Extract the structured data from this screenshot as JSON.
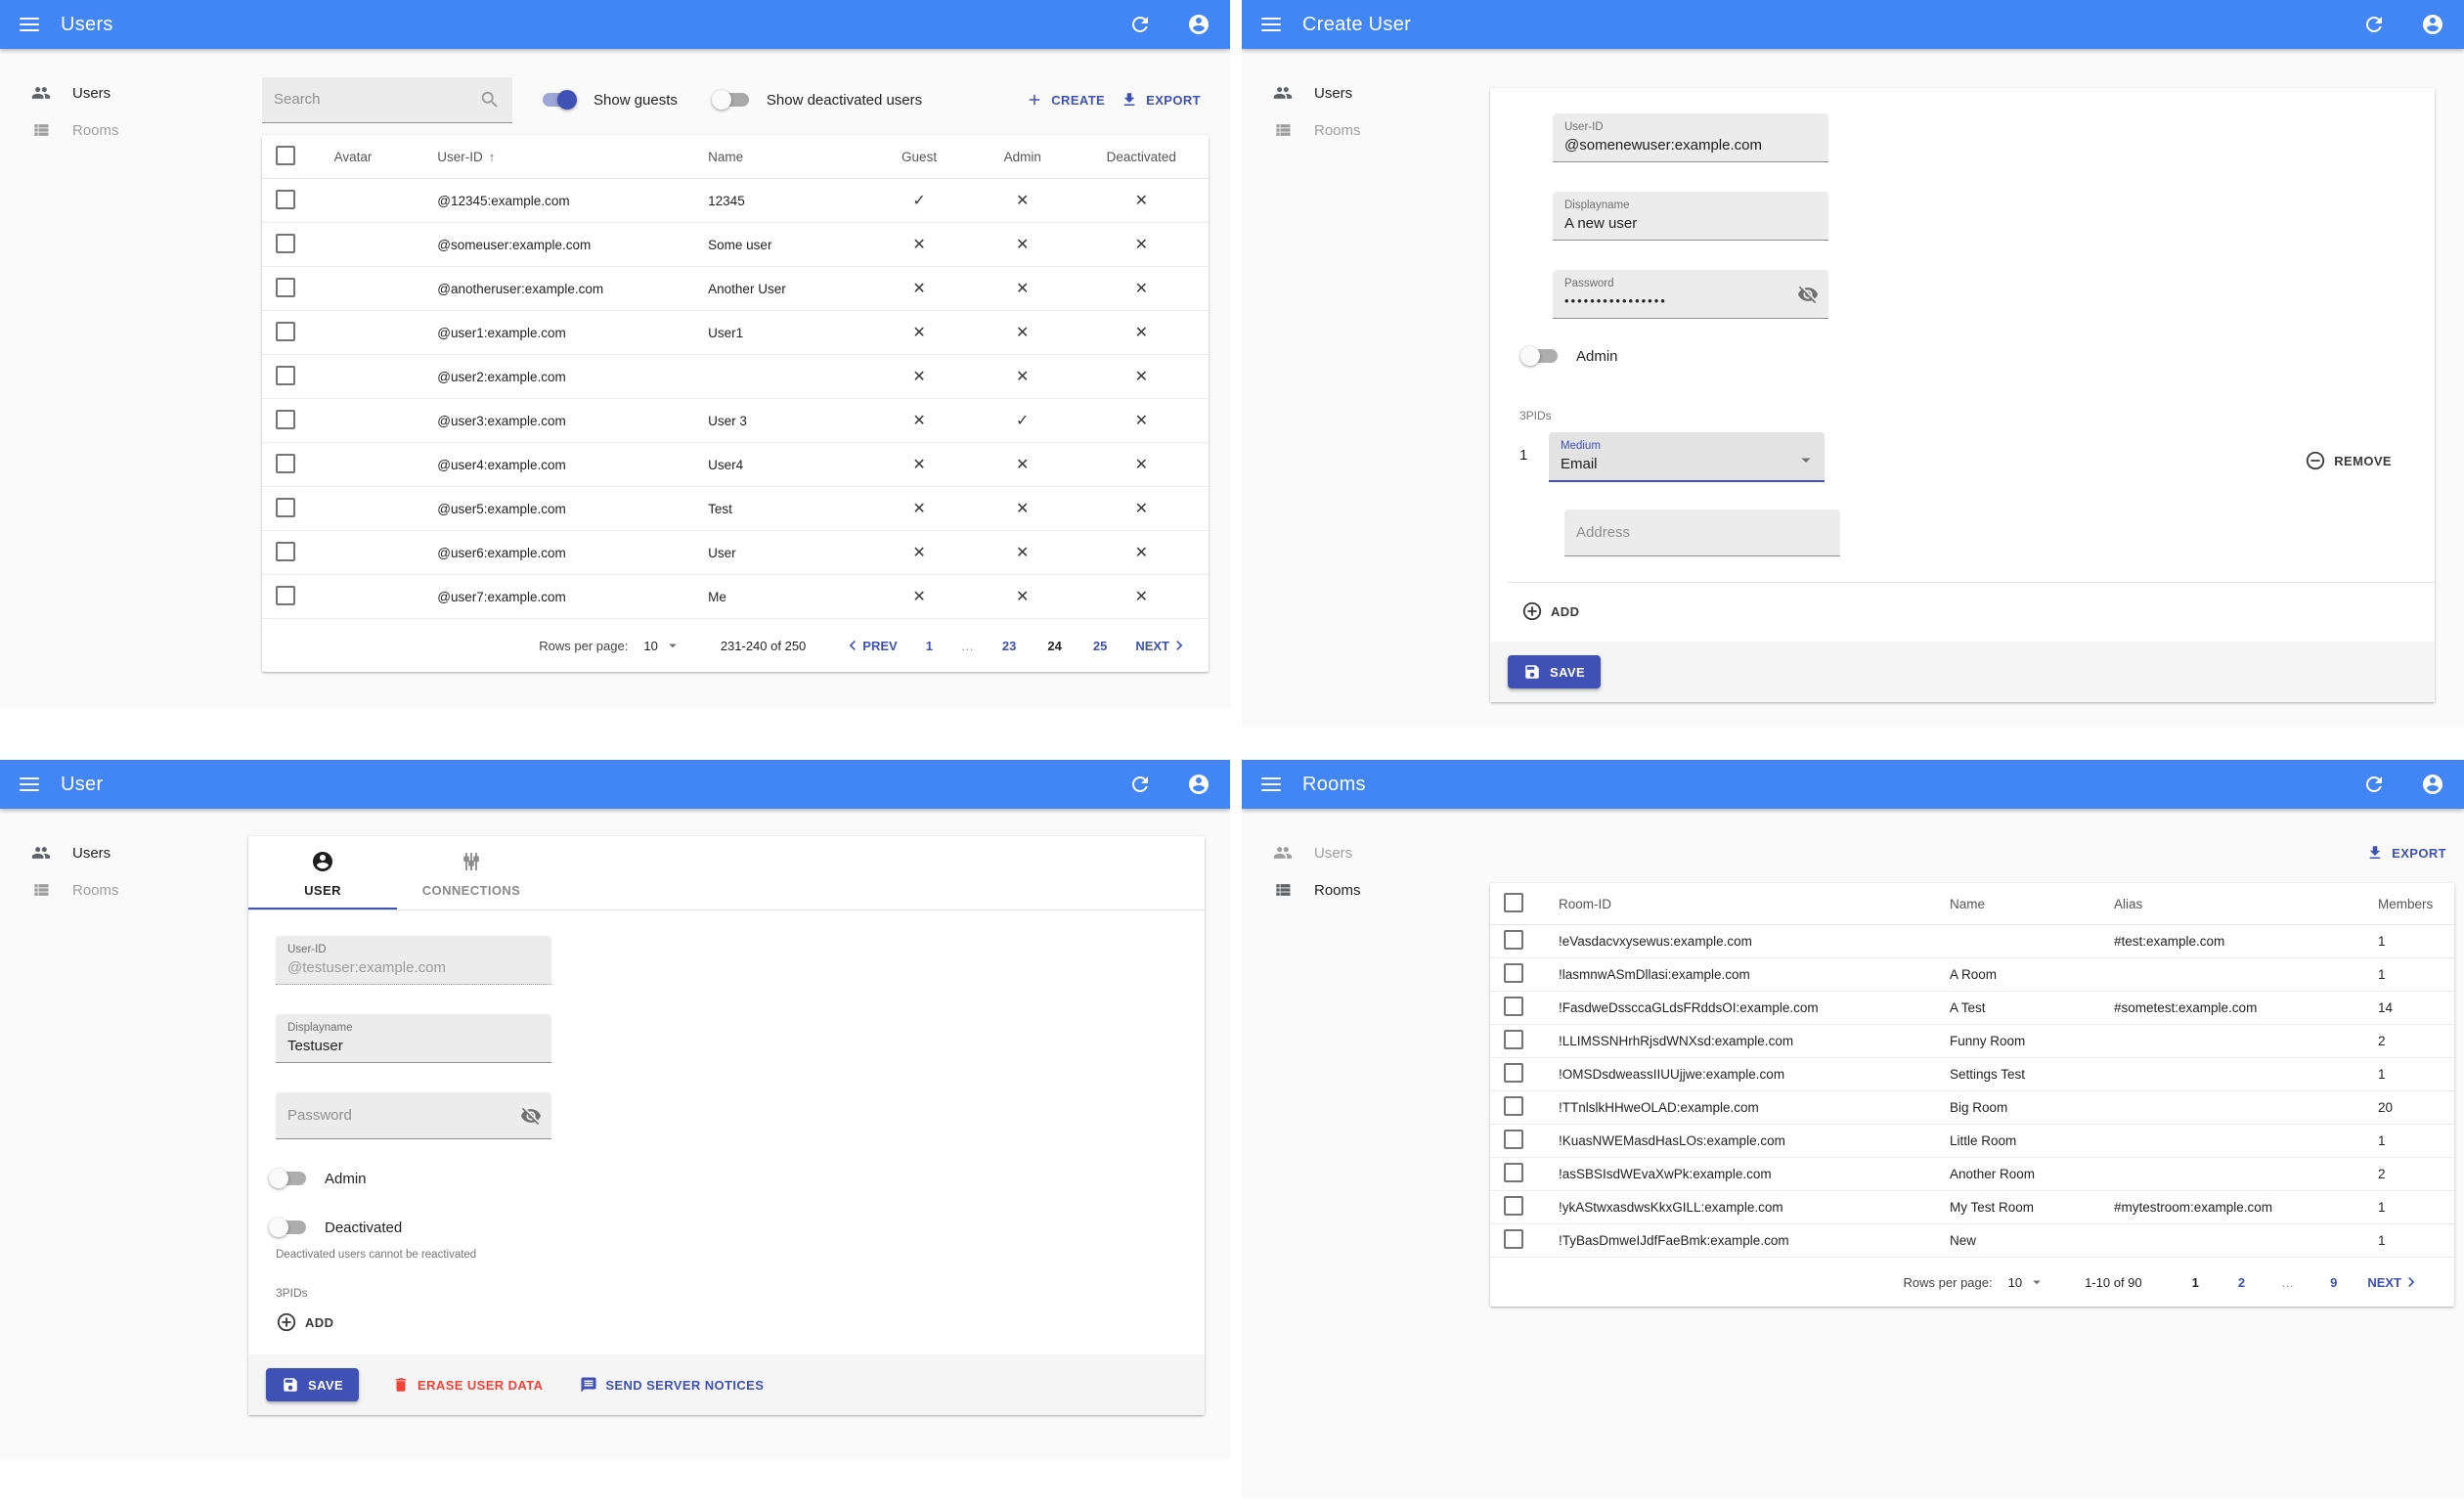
{
  "glyphs": {
    "check": "✓",
    "cross": "✕",
    "sort_up": "↑",
    "caret": "▾"
  },
  "colors": {
    "appbar": "#4285f4",
    "primary": "#3f51b5",
    "danger": "#f44336",
    "content_bg": "#fafafa"
  },
  "panels": {
    "users_list": {
      "appbar_title": "Users",
      "sidebar": {
        "users": "Users",
        "rooms": "Rooms"
      },
      "search_placeholder": "Search",
      "show_guests_label": "Show guests",
      "show_guests_on": true,
      "show_deactivated_label": "Show deactivated users",
      "show_deactivated_on": false,
      "create_label": "CREATE",
      "export_label": "EXPORT",
      "table": {
        "headers": {
          "avatar": "Avatar",
          "user_id": "User-ID",
          "name": "Name",
          "guest": "Guest",
          "admin": "Admin",
          "deactivated": "Deactivated"
        },
        "rows": [
          {
            "user_id": "@12345:example.com",
            "name": "12345",
            "guest": true,
            "admin": false,
            "deactivated": false
          },
          {
            "user_id": "@someuser:example.com",
            "name": "Some user",
            "guest": false,
            "admin": false,
            "deactivated": false
          },
          {
            "user_id": "@anotheruser:example.com",
            "name": "Another User",
            "guest": false,
            "admin": false,
            "deactivated": false
          },
          {
            "user_id": "@user1:example.com",
            "name": "User1",
            "guest": false,
            "admin": false,
            "deactivated": false
          },
          {
            "user_id": "@user2:example.com",
            "name": "",
            "guest": false,
            "admin": false,
            "deactivated": false
          },
          {
            "user_id": "@user3:example.com",
            "name": "User 3",
            "guest": false,
            "admin": true,
            "deactivated": false
          },
          {
            "user_id": "@user4:example.com",
            "name": "User4",
            "guest": false,
            "admin": false,
            "deactivated": false
          },
          {
            "user_id": "@user5:example.com",
            "name": "Test",
            "guest": false,
            "admin": false,
            "deactivated": false
          },
          {
            "user_id": "@user6:example.com",
            "name": "User",
            "guest": false,
            "admin": false,
            "deactivated": false
          },
          {
            "user_id": "@user7:example.com",
            "name": "Me",
            "guest": false,
            "admin": false,
            "deactivated": false
          }
        ]
      },
      "pagination": {
        "rows_per_page_label": "Rows per page:",
        "rows_per_page": "10",
        "range": "231-240 of 250",
        "prev_label": "PREV",
        "next_label": "NEXT",
        "pages": [
          {
            "label": "1",
            "state": "link"
          },
          {
            "label": "…",
            "state": "gap"
          },
          {
            "label": "23",
            "state": "link"
          },
          {
            "label": "24",
            "state": "current"
          },
          {
            "label": "25",
            "state": "link"
          }
        ]
      }
    },
    "create_user": {
      "appbar_title": "Create User",
      "sidebar": {
        "users": "Users",
        "rooms": "Rooms"
      },
      "fields": {
        "user_id_label": "User-ID",
        "user_id_value": "@somenewuser:example.com",
        "displayname_label": "Displayname",
        "displayname_value": "A new user",
        "password_label": "Password",
        "password_value": "••••••••••••••••",
        "admin_label": "Admin",
        "threepids_label": "3PIDs",
        "threepid_index": "1",
        "medium_label": "Medium",
        "medium_value": "Email",
        "address_placeholder": "Address"
      },
      "remove_label": "REMOVE",
      "add_label": "ADD",
      "save_label": "SAVE"
    },
    "user_edit": {
      "appbar_title": "User",
      "sidebar": {
        "users": "Users",
        "rooms": "Rooms"
      },
      "tabs": {
        "user": "USER",
        "connections": "CONNECTIONS"
      },
      "fields": {
        "user_id_label": "User-ID",
        "user_id_value": "@testuser:example.com",
        "displayname_label": "Displayname",
        "displayname_value": "Testuser",
        "password_placeholder": "Password",
        "admin_label": "Admin",
        "deactivated_label": "Deactivated",
        "deactivated_helper": "Deactivated users cannot be reactivated",
        "threepids_label": "3PIDs"
      },
      "add_label": "ADD",
      "save_label": "SAVE",
      "erase_label": "ERASE USER DATA",
      "notices_label": "SEND SERVER NOTICES"
    },
    "rooms_list": {
      "appbar_title": "Rooms",
      "sidebar": {
        "users": "Users",
        "rooms": "Rooms"
      },
      "export_label": "EXPORT",
      "table": {
        "headers": {
          "room_id": "Room-ID",
          "name": "Name",
          "alias": "Alias",
          "members": "Members"
        },
        "rows": [
          {
            "room_id": "!eVasdacvxysewus:example.com",
            "name": "",
            "alias": "#test:example.com",
            "members": "1"
          },
          {
            "room_id": "!lasmnwASmDllasi:example.com",
            "name": "A Room",
            "alias": "",
            "members": "1"
          },
          {
            "room_id": "!FasdweDssccaGLdsFRddsOI:example.com",
            "name": "A Test",
            "alias": "#sometest:example.com",
            "members": "14"
          },
          {
            "room_id": "!LLIMSSNHrhRjsdWNXsd:example.com",
            "name": "Funny Room",
            "alias": "",
            "members": "2"
          },
          {
            "room_id": "!OMSDsdweassIIUUjjwe:example.com",
            "name": "Settings Test",
            "alias": "",
            "members": "1"
          },
          {
            "room_id": "!TTnlslkHHweOLAD:example.com",
            "name": "Big Room",
            "alias": "",
            "members": "20"
          },
          {
            "room_id": "!KuasNWEMasdHasLOs:example.com",
            "name": "Little Room",
            "alias": "",
            "members": "1"
          },
          {
            "room_id": "!asSBSIsdWEvaXwPk:example.com",
            "name": "Another Room",
            "alias": "",
            "members": "2"
          },
          {
            "room_id": "!ykAStwxasdwsKkxGILL:example.com",
            "name": "My Test Room",
            "alias": "#mytestroom:example.com",
            "members": "1"
          },
          {
            "room_id": "!TyBasDmweIJdfFaeBmk:example.com",
            "name": "New",
            "alias": "",
            "members": "1"
          }
        ]
      },
      "pagination": {
        "rows_per_page_label": "Rows per page:",
        "rows_per_page": "10",
        "range": "1-10 of 90",
        "next_label": "NEXT",
        "pages": [
          {
            "label": "1",
            "state": "current"
          },
          {
            "label": "2",
            "state": "link"
          },
          {
            "label": "…",
            "state": "gap"
          },
          {
            "label": "9",
            "state": "link"
          }
        ]
      }
    }
  }
}
